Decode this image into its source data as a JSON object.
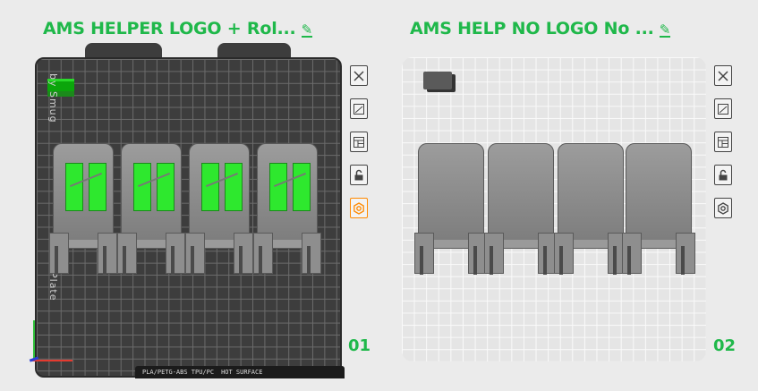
{
  "plates": [
    {
      "title": "AMS HELPER LOGO + Rol...",
      "number": "01",
      "vertical_text_top": "by Smug",
      "vertical_text_bottom": "Plate",
      "bottom_strip": "PLA/PETG-ABS TPU/PC",
      "bottom_strip_small": "HOT SURFACE"
    },
    {
      "title": "AMS HELP NO LOGO No ...",
      "number": "02"
    }
  ],
  "edit_icon": "pencil-icon",
  "toolbar_icons": [
    "close-icon",
    "auto-orient-icon",
    "arrange-icon",
    "lock-icon",
    "settings-hex-icon"
  ],
  "colors": {
    "accent": "#1fb84a",
    "active_border": "#ff8a00",
    "logo_green": "#2ee82e"
  }
}
